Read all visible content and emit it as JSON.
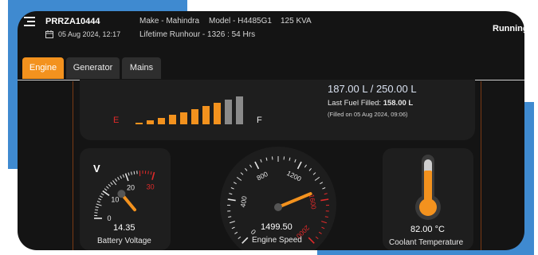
{
  "header": {
    "device_id": "PRRZA10444",
    "date": "05 Aug 2024, 12:17",
    "make": "Make - Mahindra",
    "model": "Model - H4485G1",
    "kva": "125 KVA",
    "runhour": "Lifetime Runhour - 1326 : 54 Hrs",
    "status": "Running",
    "menu_icon": "hamburger-menu-icon",
    "calendar_icon": "calendar-icon"
  },
  "tabs": [
    {
      "label": "Engine",
      "active": true
    },
    {
      "label": "Generator",
      "active": false
    },
    {
      "label": "Mains",
      "active": false
    }
  ],
  "fuel": {
    "empty_label": "E",
    "full_label": "F",
    "level_text": "187.00 L / 250.00 L",
    "last_filled_label": "Last Fuel Filled:",
    "last_filled_value": "158.00 L",
    "filled_on": "(Filled on 05 Aug 2024, 09:06)",
    "bars_filled": 8,
    "bars_total": 10,
    "fill_color": "#f3921e",
    "empty_color": "#8a8a8a"
  },
  "battery": {
    "unit": "V",
    "ticks": [
      "0",
      "10",
      "20",
      "30"
    ],
    "value": "14.35",
    "label": "Battery Voltage"
  },
  "engine_speed": {
    "ticks": [
      "0",
      "400",
      "800",
      "1200",
      "1600",
      "2000"
    ],
    "value": "1499.50",
    "label": "Engine Speed"
  },
  "coolant": {
    "value": "82.00 °C",
    "label": "Coolant Temperature",
    "thermometer_icon": "thermometer-icon"
  },
  "colors": {
    "accent": "#f3921e",
    "redline": "#e02a2a",
    "background": "#141414",
    "decor_blue": "#3f8ad0"
  }
}
